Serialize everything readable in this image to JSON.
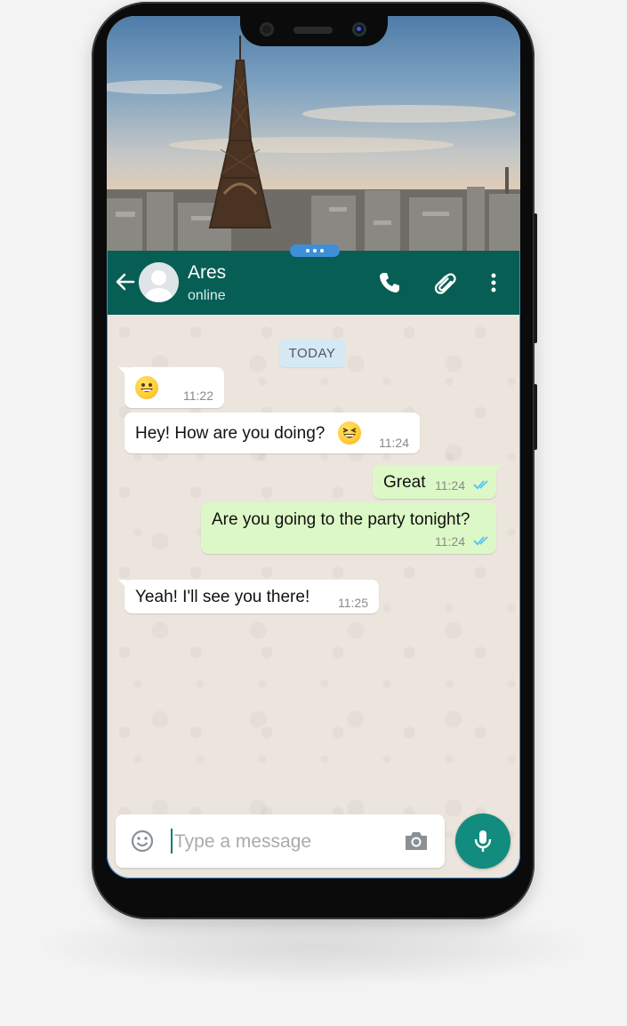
{
  "contact": {
    "name": "Ares",
    "status": "online"
  },
  "header_icons": [
    "back-arrow-icon",
    "phone-icon",
    "paperclip-icon",
    "more-vert-icon"
  ],
  "date_divider": "TODAY",
  "messages": [
    {
      "direction": "in",
      "text": "",
      "emoji": "grinning-face",
      "time": "11:22"
    },
    {
      "direction": "in",
      "text": "Hey! How are you doing?",
      "emoji": "laughing-face",
      "time": "11:24"
    },
    {
      "direction": "out",
      "text": "Great",
      "time": "11:24",
      "read": true
    },
    {
      "direction": "out",
      "text": "Are you going to the party tonight?",
      "time": "11:24",
      "read": true
    },
    {
      "direction": "in",
      "text": "Yeah! I'll see you there!",
      "time": "11:25"
    }
  ],
  "composer": {
    "placeholder": "Type a message",
    "value": ""
  },
  "colors": {
    "header": "#075e54",
    "outgoing_bubble": "#dcf8c6",
    "incoming_bubble": "#ffffff",
    "mic_button": "#128c7e",
    "read_ticks": "#4fc3f7",
    "chat_background": "#ece5dd"
  }
}
